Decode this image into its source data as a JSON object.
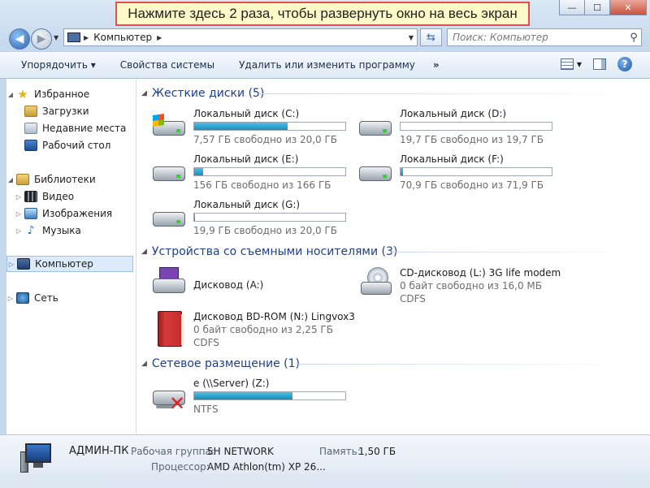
{
  "window": {
    "minimize": "—",
    "maximize": "☐",
    "close": "✕",
    "tooltip": "Нажмите здесь 2 раза, чтобы развернуть окно на весь экран"
  },
  "address": {
    "path": "Компьютер",
    "search_placeholder": "Поиск: Компьютер"
  },
  "toolbar": {
    "organize": "Упорядочить ▾",
    "system_properties": "Свойства системы",
    "uninstall": "Удалить или изменить программу",
    "more": "»"
  },
  "nav": {
    "favorites": "Избранное",
    "downloads": "Загрузки",
    "recent": "Недавние места",
    "desktop": "Рабочий стол",
    "libraries": "Библиотеки",
    "video": "Видео",
    "images": "Изображения",
    "music": "Музыка",
    "computer": "Компьютер",
    "network": "Сеть"
  },
  "groups": {
    "hard_drives": "Жесткие диски (5)",
    "removable": "Устройства со съемными носителями (3)",
    "network": "Сетевое размещение (1)"
  },
  "drives": [
    {
      "name": "Локальный диск (C:)",
      "free": "7,57 ГБ свободно из 20,0 ГБ",
      "used_fraction": 0.62
    },
    {
      "name": "Локальный диск (D:)",
      "free": "19,7 ГБ свободно из 19,7 ГБ",
      "used_fraction": 0.0
    },
    {
      "name": "Локальный диск (E:)",
      "free": "156 ГБ свободно из 166 ГБ",
      "used_fraction": 0.06
    },
    {
      "name": "Локальный диск (F:)",
      "free": "70,9 ГБ свободно из 71,9 ГБ",
      "used_fraction": 0.014
    },
    {
      "name": "Локальный диск (G:)",
      "free": "19,9 ГБ свободно из 20,0 ГБ",
      "used_fraction": 0.005
    }
  ],
  "removable": [
    {
      "name": "Дисковод (A:)"
    },
    {
      "name": "CD-дисковод (L:) 3G life modem",
      "free": "0 байт свободно из 16,0 МБ",
      "fs": "CDFS"
    },
    {
      "name": "Дисковод BD-ROM (N:) Lingvox3",
      "free": "0 байт свободно из 2,25 ГБ",
      "fs": "CDFS"
    }
  ],
  "network_drives": [
    {
      "name": "e (\\\\Server) (Z:)",
      "fs": "NTFS",
      "used_fraction": 0.65
    }
  ],
  "details": {
    "computer_name": "АДМИН-ПК",
    "workgroup_label": "Рабочая группа:",
    "workgroup_value": "5H NETWORK",
    "memory_label": "Память:",
    "memory_value": "1,50 ГБ",
    "cpu_label": "Процессор:",
    "cpu_value": "AMD Athlon(tm) XP 26..."
  }
}
